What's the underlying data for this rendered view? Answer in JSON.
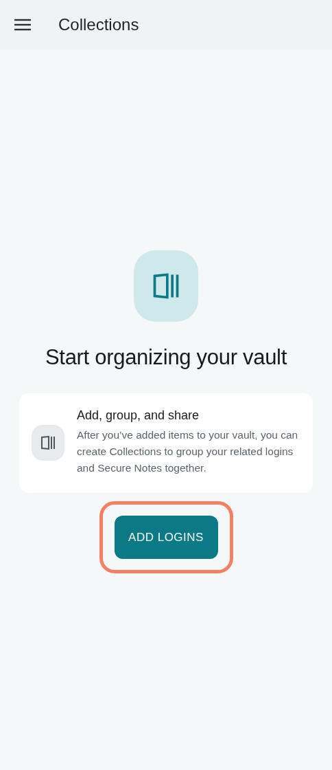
{
  "app_bar": {
    "title": "Collections"
  },
  "empty_state": {
    "heading": "Start organizing your vault",
    "card": {
      "title": "Add, group, and share",
      "body": "After you’ve added items to your vault, you can create Collections to group your related logins and Secure Notes together."
    },
    "button": {
      "label": "ADD LOGINS",
      "highlighted": true
    }
  }
}
